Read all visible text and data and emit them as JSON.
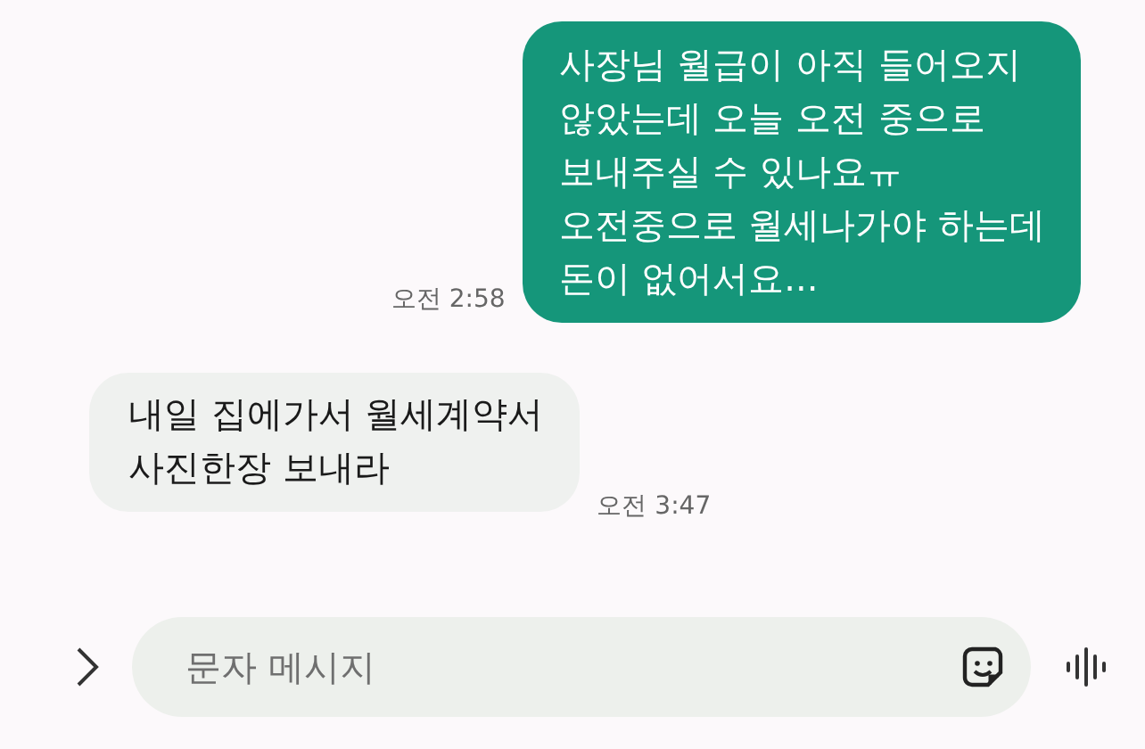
{
  "messages": [
    {
      "kind": "sent",
      "text": "사장님 월급이 아직 들어오지\n않았는데 오늘 오전 중으로\n보내주실 수 있나요ㅠ\n오전중으로 월세나가야 하는데\n돈이 없어서요...",
      "time": "오전 2:58"
    },
    {
      "kind": "received",
      "text": "내일 집에가서 월세계약서\n사진한장 보내라",
      "time": "오전 3:47"
    }
  ],
  "composer": {
    "placeholder": "문자 메시지"
  }
}
